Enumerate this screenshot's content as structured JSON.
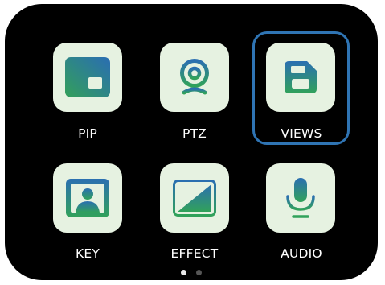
{
  "menu": {
    "items": [
      {
        "id": "pip",
        "label": "PIP",
        "icon": "pip-icon",
        "selected": false
      },
      {
        "id": "ptz",
        "label": "PTZ",
        "icon": "webcam-icon",
        "selected": false
      },
      {
        "id": "views",
        "label": "VIEWS",
        "icon": "floppy-disk-icon",
        "selected": true
      },
      {
        "id": "key",
        "label": "KEY",
        "icon": "portrait-key-icon",
        "selected": false
      },
      {
        "id": "effect",
        "label": "EFFECT",
        "icon": "transition-effect-icon",
        "selected": false
      },
      {
        "id": "audio",
        "label": "AUDIO",
        "icon": "microphone-icon",
        "selected": false
      }
    ]
  },
  "pager": {
    "page_count": 2,
    "current_page": 1
  },
  "colors": {
    "screen_bg": "#000000",
    "tile_bg": "#e6f2e1",
    "icon_gradient_start": "#2e9a5e",
    "icon_gradient_end": "#2c6fb0",
    "selection_border": "#2f74b3",
    "label_text": "#ffffff"
  }
}
